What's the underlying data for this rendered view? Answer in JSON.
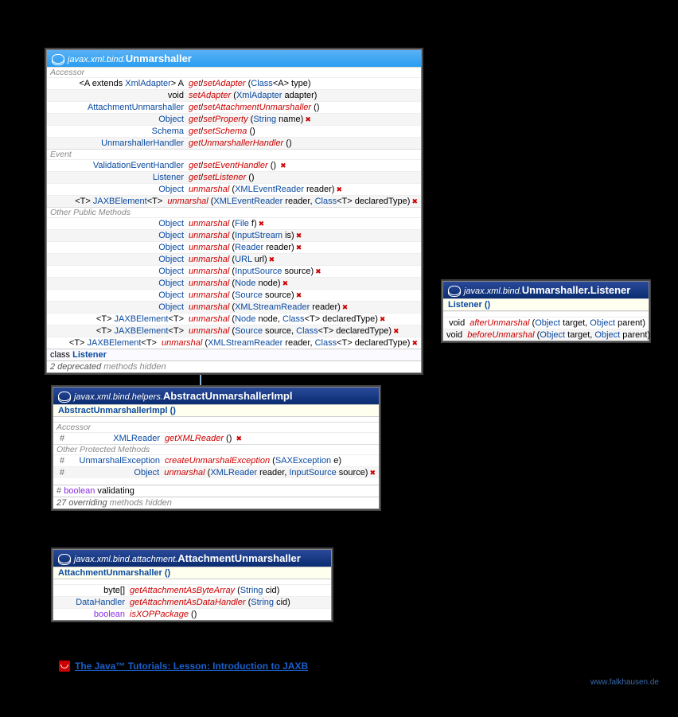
{
  "unmarshaller": {
    "pkg": "javax.xml.bind.",
    "name": "Unmarshaller",
    "sections": {
      "accessor": "Accessor",
      "event": "Event",
      "other": "Other Public Methods"
    },
    "rows": {
      "a1_ret": "<A extends XmlAdapter> A",
      "a1_m": "get",
      "a1_s": "/",
      "a1_m2": "setAdapter",
      "a1_p": " (Class<A> type)",
      "a2_ret": "void",
      "a2_m": "setAdapter",
      "a2_p": " (XmlAdapter adapter)",
      "a3_ret": "AttachmentUnmarshaller",
      "a3_m": "get",
      "a3_s": "/",
      "a3_m2": "setAttachmentUnmarshaller",
      "a3_p": " ()",
      "a4_ret": "Object",
      "a4_m": "get",
      "a4_s": "/",
      "a4_m2": "setProperty",
      "a4_p": " (String name) ",
      "a4_exc": "✖",
      "a5_ret": "Schema",
      "a5_m": "get",
      "a5_s": "/",
      "a5_m2": "setSchema",
      "a5_p": " ()",
      "a6_ret": "UnmarshallerHandler",
      "a6_m": "getUnmarshallerHandler",
      "a6_p": " ()",
      "e1_ret": "ValidationEventHandler",
      "e1_m": "get",
      "e1_s": "/",
      "e1_m2": "setEventHandler",
      "e1_p": " () ",
      "e1_exc": "✖",
      "e2_ret": "Listener",
      "e2_m": "get",
      "e2_s": "/",
      "e2_m2": "setListener",
      "e2_p": " ()",
      "e3_ret": "Object",
      "e3_m": "unmarshal",
      "e3_p": " (XMLEventReader reader) ",
      "e3_exc": "✖",
      "e4_ret": "<T> JAXBElement<T>",
      "e4_m": "unmarshal",
      "e4_p": " (XMLEventReader reader, Class<T> declaredType) ",
      "e4_exc": "✖",
      "o1_ret": "Object",
      "o1_m": "unmarshal",
      "o1_p": " (File f) ",
      "o1_exc": "✖",
      "o2_ret": "Object",
      "o2_m": "unmarshal",
      "o2_p": " (InputStream is) ",
      "o2_exc": "✖",
      "o3_ret": "Object",
      "o3_m": "unmarshal",
      "o3_p": " (Reader reader) ",
      "o3_exc": "✖",
      "o4_ret": "Object",
      "o4_m": "unmarshal",
      "o4_p": " (URL url) ",
      "o4_exc": "✖",
      "o5_ret": "Object",
      "o5_m": "unmarshal",
      "o5_p": " (InputSource source) ",
      "o5_exc": "✖",
      "o6_ret": "Object",
      "o6_m": "unmarshal",
      "o6_p": " (Node node) ",
      "o6_exc": "✖",
      "o7_ret": "Object",
      "o7_m": "unmarshal",
      "o7_p": " (Source source) ",
      "o7_exc": "✖",
      "o8_ret": "Object",
      "o8_m": "unmarshal",
      "o8_p": " (XMLStreamReader reader) ",
      "o8_exc": "✖",
      "o9_ret": "<T> JAXBElement<T>",
      "o9_m": "unmarshal",
      "o9_p": " (Node node, Class<T> declaredType) ",
      "o9_exc": "✖",
      "o10_ret": "<T> JAXBElement<T>",
      "o10_m": "unmarshal",
      "o10_p": " (Source source, Class<T> declaredType) ",
      "o10_exc": "✖",
      "o11_ret": "<T> JAXBElement<T>",
      "o11_m": "unmarshal",
      "o11_p": " (XMLStreamReader reader, Class<T> declaredType) ",
      "o11_exc": "✖"
    },
    "inner_class_prefix": "class ",
    "inner_class": "Listener",
    "deprecated": "2 deprecated methods hidden"
  },
  "listener": {
    "pkg": "javax.xml.bind.",
    "name": "Unmarshaller.Listener",
    "ctor": "Listener ()",
    "r1_ret": "void",
    "r1_m": "afterUnmarshal",
    "r1_p": " (Object target, Object parent)",
    "r2_ret": "void",
    "r2_m": "beforeUnmarshal",
    "r2_p": " (Object target, Object parent)"
  },
  "abs": {
    "pkg": "javax.xml.bind.helpers.",
    "name": "AbstractUnmarshallerImpl",
    "ctor": "AbstractUnmarshallerImpl ()",
    "sec_accessor": "Accessor",
    "sec_other": "Other Protected Methods",
    "r1_ret": "XMLReader",
    "r1_m": "getXMLReader",
    "r1_p": " () ",
    "r1_exc": "✖",
    "r2_ret": "UnmarshalException",
    "r2_m": "createUnmarshalException",
    "r2_p": " (SAXException e)",
    "r3_ret": "Object",
    "r3_m": "unmarshal",
    "r3_p": " (XMLReader reader, InputSource source) ",
    "r3_exc": "✖",
    "field_hash": "#",
    "field_kw": "boolean ",
    "field_name": "validating",
    "overriding": "27 overriding methods hidden"
  },
  "att": {
    "pkg": "javax.xml.bind.attachment.",
    "name": "AttachmentUnmarshaller",
    "ctor": "AttachmentUnmarshaller ()",
    "r1_ret": "byte[]",
    "r1_m": "getAttachmentAsByteArray",
    "r1_p": " (String cid)",
    "r2_ret": "DataHandler",
    "r2_m": "getAttachmentAsDataHandler",
    "r2_p": " (String cid)",
    "r3_ret": "boolean",
    "r3_m": "isXOPPackage",
    "r3_p": " ()"
  },
  "link": "The Java™ Tutorials: Lesson: Introduction to JAXB",
  "site": "www.falkhausen.de"
}
